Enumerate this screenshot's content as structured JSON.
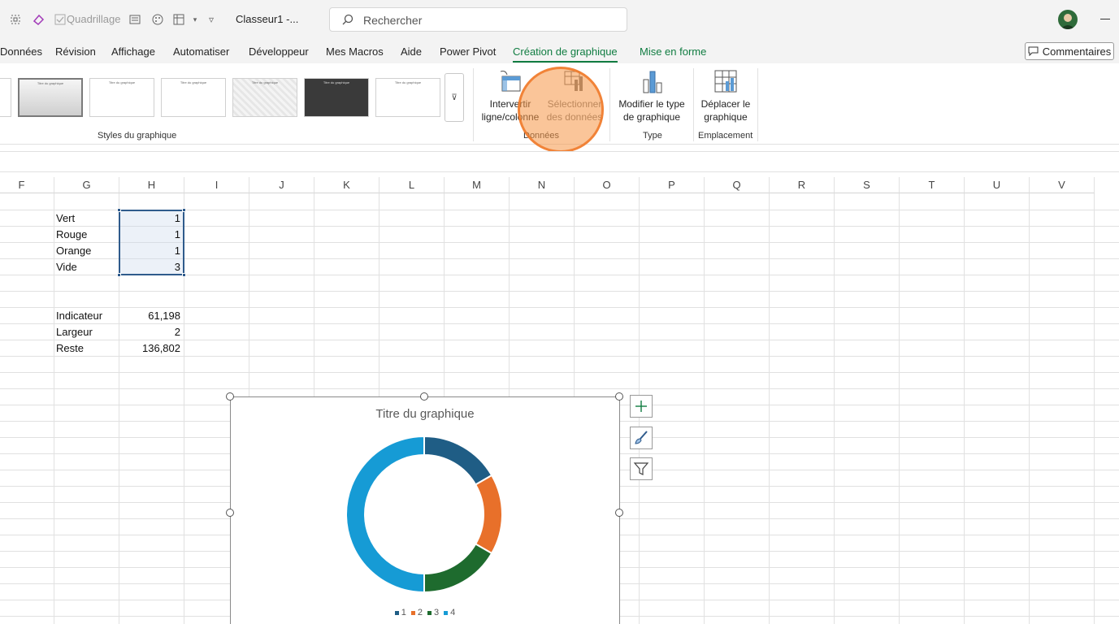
{
  "titlebar": {
    "gridlines_label": "Quadrillage",
    "doc_title": "Classeur1  -...",
    "search_placeholder": "Rechercher"
  },
  "tabs": [
    {
      "label": "Données"
    },
    {
      "label": "Révision"
    },
    {
      "label": "Affichage"
    },
    {
      "label": "Automatiser"
    },
    {
      "label": "Développeur"
    },
    {
      "label": "Mes Macros"
    },
    {
      "label": "Aide"
    },
    {
      "label": "Power Pivot"
    },
    {
      "label": "Création de graphique"
    },
    {
      "label": "Mise en forme"
    }
  ],
  "comments_label": "Commentaires",
  "ribbon": {
    "chart_styles_group": "Styles du graphique",
    "style_thumbs": [
      "Titre du graphique",
      "Titre du graphique",
      "Titre du graphique",
      "Titre du graphique",
      "Titre du graphique",
      "Titre du graphique"
    ],
    "data_group": "Données",
    "switch_row_col": [
      "Intervertir",
      "ligne/colonne"
    ],
    "select_data": [
      "Sélectionner",
      "des données"
    ],
    "type_group": "Type",
    "change_type": [
      "Modifier le type",
      "de graphique"
    ],
    "location_group": "Emplacement",
    "move_chart": [
      "Déplacer le",
      "graphique"
    ]
  },
  "columns": [
    "F",
    "G",
    "H",
    "I",
    "J",
    "K",
    "L",
    "M",
    "N",
    "O",
    "P",
    "Q",
    "R",
    "S",
    "T",
    "U",
    "V"
  ],
  "cells": {
    "rows1": [
      {
        "label": "Vert",
        "value": "1"
      },
      {
        "label": "Rouge",
        "value": "1"
      },
      {
        "label": "Orange",
        "value": "1"
      },
      {
        "label": "Vide",
        "value": "3"
      }
    ],
    "rows2": [
      {
        "label": "Indicateur",
        "value": "61,198"
      },
      {
        "label": "Largeur",
        "value": "2"
      },
      {
        "label": "Reste",
        "value": "136,802"
      }
    ]
  },
  "chart_data": {
    "type": "pie",
    "title": "Titre du graphique",
    "categories": [
      "1",
      "2",
      "3",
      "4"
    ],
    "values": [
      1,
      1,
      1,
      3
    ],
    "colors": [
      "#1f5d85",
      "#e8702a",
      "#1e6b2e",
      "#169bd5"
    ],
    "legend": "bottom",
    "donut": true
  }
}
